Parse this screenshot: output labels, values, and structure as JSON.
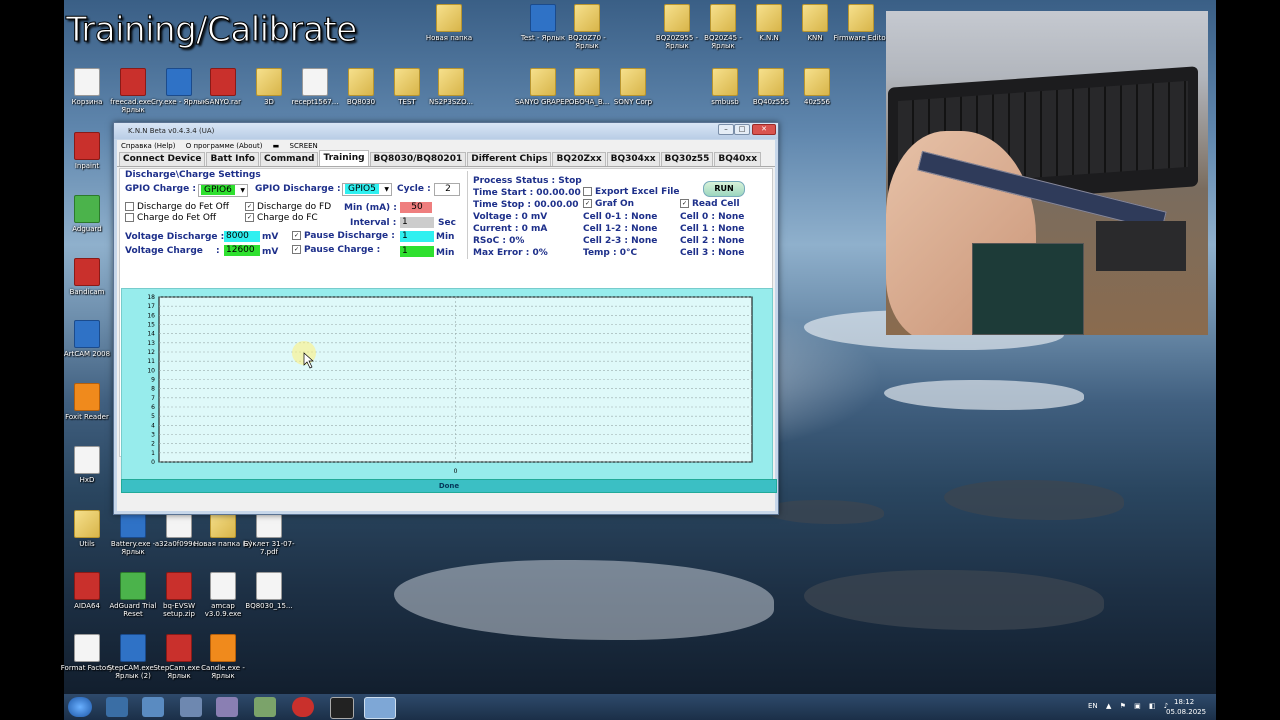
{
  "overlay_title": "Training/Calibrate",
  "desktop_icons": [
    {
      "label": "Новая папка",
      "type": "folder"
    },
    {
      "label": "Test - Ярлык",
      "type": "app"
    },
    {
      "label": "BQ20Z70 - Ярлык",
      "type": "folder"
    },
    {
      "label": "BQ20Z955 - Ярлык",
      "type": "folder"
    },
    {
      "label": "BQ20Z45 - Ярлык",
      "type": "folder"
    },
    {
      "label": "K.N.N",
      "type": "folder"
    },
    {
      "label": "KNN",
      "type": "folder"
    },
    {
      "label": "Firmware Editor",
      "type": "folder"
    },
    {
      "label": "Корзина",
      "type": "file"
    },
    {
      "label": "freecad.exe - Ярлык",
      "type": "red"
    },
    {
      "label": "Cry.exe - Ярлык",
      "type": "app"
    },
    {
      "label": "SANYO.rar",
      "type": "red"
    },
    {
      "label": "3D",
      "type": "folder"
    },
    {
      "label": "recept1567...",
      "type": "file"
    },
    {
      "label": "BQ8030",
      "type": "folder"
    },
    {
      "label": "TEST",
      "type": "folder"
    },
    {
      "label": "NS2P3SZO...",
      "type": "folder"
    },
    {
      "label": "SANYO GRAPE...",
      "type": "folder"
    },
    {
      "label": "РОБОЧА_В...",
      "type": "folder"
    },
    {
      "label": "SONY Corp",
      "type": "folder"
    },
    {
      "label": "smbusb",
      "type": "folder"
    },
    {
      "label": "BQ40z555",
      "type": "folder"
    },
    {
      "label": "40z556",
      "type": "folder"
    },
    {
      "label": "Inpaint",
      "type": "red"
    },
    {
      "label": "Adguard",
      "type": "grn"
    },
    {
      "label": "Bandicam",
      "type": "red"
    },
    {
      "label": "ArtCAM 2008",
      "type": "app"
    },
    {
      "label": "Foxit Reader",
      "type": "org"
    },
    {
      "label": "HxD",
      "type": "file"
    },
    {
      "label": "Utils",
      "type": "folder"
    },
    {
      "label": "Battery.exe - Ярлык",
      "type": "app"
    },
    {
      "label": "a32a0f099c...",
      "type": "file"
    },
    {
      "label": "Новая папка (2)",
      "type": "folder"
    },
    {
      "label": "Буклет 31-07-7.pdf",
      "type": "file"
    },
    {
      "label": "AIDA64",
      "type": "red"
    },
    {
      "label": "AdGuard Trial Reset",
      "type": "grn"
    },
    {
      "label": "bq-EVSW setup.zip",
      "type": "red"
    },
    {
      "label": "amcap v3.0.9.exe",
      "type": "file"
    },
    {
      "label": "BQ8030_15...",
      "type": "file"
    },
    {
      "label": "Format Factory",
      "type": "file"
    },
    {
      "label": "StepCAM.exe - Ярлык (2)",
      "type": "app"
    },
    {
      "label": "StepCam.exe - Ярлык",
      "type": "red"
    },
    {
      "label": "Candle.exe - Ярлык",
      "type": "org"
    }
  ],
  "window": {
    "title": "K.N.N Beta v0.4.3.4 (UA)",
    "menu": [
      "Справка (Help)",
      "О программе (About)",
      "SCREEN"
    ],
    "tabs": [
      "Connect Device",
      "Batt Info",
      "Command",
      "Training",
      "BQ8030/BQ80201",
      "Different Chips",
      "BQ20Zxx",
      "BQ304xx",
      "BQ30z55",
      "BQ40xx"
    ],
    "active_tab": "Training",
    "settings": {
      "section_title": "Discharge\\Charge Settings",
      "gpio_charge_label": "GPIO Charge :",
      "gpio_charge_value": "GPIO6",
      "gpio_discharge_label": "GPIO Discharge :",
      "gpio_discharge_value": "GPIO5",
      "cycle_label": "Cycle :",
      "cycle_value": "2",
      "discharge_fet_off": "Discharge do Fet Off",
      "charge_fet_off": "Charge do Fet Off",
      "discharge_fd": "Discharge do FD",
      "charge_fc": "Charge do FC",
      "min_ma_label": "Min (mA) :",
      "min_ma_value": "50",
      "interval_label": "Interval :",
      "interval_value": "1",
      "interval_unit": "Sec",
      "voltage_discharge_label": "Voltage Discharge :",
      "voltage_discharge_value": "8000",
      "voltage_charge_label": "Voltage Charge",
      "voltage_charge_value": "12600",
      "mv_unit": "mV",
      "pause_discharge_label": "Pause Discharge :",
      "pause_discharge_value": "1",
      "pause_charge_label": "Pause Charge",
      "pause_charge_value": "1",
      "min_unit": "Min"
    },
    "status": {
      "process_status": "Process Status : Stop",
      "time_start": "Time Start : 00.00.00",
      "time_stop": "Time Stop  : 00.00.00",
      "voltage": "Voltage  : 0 mV",
      "current": "Current  : 0 mA",
      "rsoc": "RSoC : 0%",
      "max_error": "Max Error : 0%",
      "export_excel": "Export Excel File",
      "graf_on": "Graf On",
      "read_cell": "Read Cell",
      "run": "RUN",
      "cell01": "Cell 0-1 : None",
      "cell12": "Cell 1-2 : None",
      "cell23": "Cell 2-3 : None",
      "temp": "Temp : 0°C",
      "cell0": "Cell 0 : None",
      "cell1": "Cell 1 : None",
      "cell2": "Cell 2 : None",
      "cell3": "Cell 3 : None"
    },
    "progress_text": "Done"
  },
  "chart_data": {
    "type": "line",
    "series": [],
    "x_ticks": [
      "0"
    ],
    "y_ticks": [
      0,
      1,
      2,
      3,
      4,
      5,
      6,
      7,
      8,
      9,
      10,
      11,
      12,
      13,
      14,
      15,
      16,
      17,
      18
    ],
    "ylim": [
      0,
      18
    ],
    "grid": true
  },
  "taskbar": {
    "language": "EN",
    "time": "18:12",
    "date": "05.08.2025"
  },
  "colors": {
    "chart_bg": "#97ecec",
    "gpio_green": "#2fe02f",
    "gpio_cyan": "#2ff0f0",
    "min_ma_bg": "#ef7e7e",
    "progress": "#3bbfc4"
  }
}
